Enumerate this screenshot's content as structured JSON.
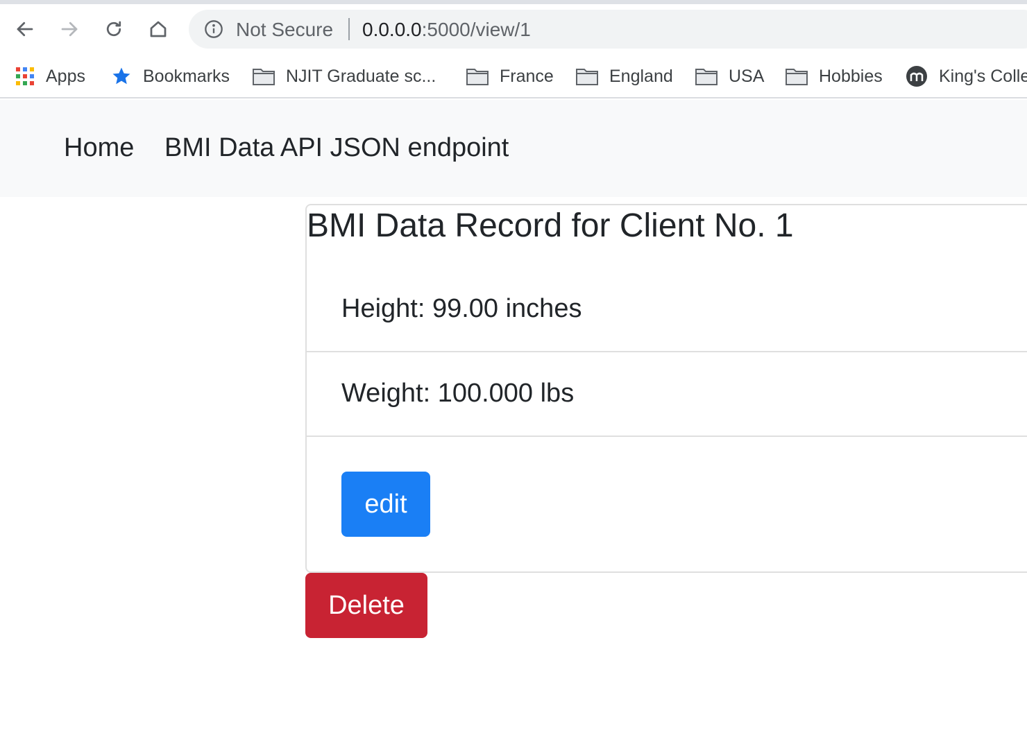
{
  "browser": {
    "security_label": "Not Secure",
    "url_host": "0.0.0.0",
    "url_rest": ":5000/view/1"
  },
  "bookmarks": [
    {
      "label": "Apps",
      "icon": "apps-grid-icon"
    },
    {
      "label": "Bookmarks",
      "icon": "star-icon"
    },
    {
      "label": "NJIT Graduate sc...",
      "icon": "folder-icon"
    },
    {
      "label": "France",
      "icon": "folder-icon"
    },
    {
      "label": "England",
      "icon": "folder-icon"
    },
    {
      "label": "USA",
      "icon": "folder-icon"
    },
    {
      "label": "Hobbies",
      "icon": "folder-icon"
    },
    {
      "label": "King's Colle",
      "icon": "site-logo-icon"
    }
  ],
  "navbar": {
    "home": "Home",
    "api": "BMI Data API JSON endpoint"
  },
  "record": {
    "title": "BMI Data Record for Client No. 1",
    "height": "Height: 99.00 inches",
    "weight": "Weight: 100.000 lbs"
  },
  "actions": {
    "edit": "edit",
    "delete": "Delete"
  },
  "colors": {
    "primary": "#1a7ff5",
    "danger": "#c82333",
    "navbar_bg": "#f8f9fa"
  }
}
